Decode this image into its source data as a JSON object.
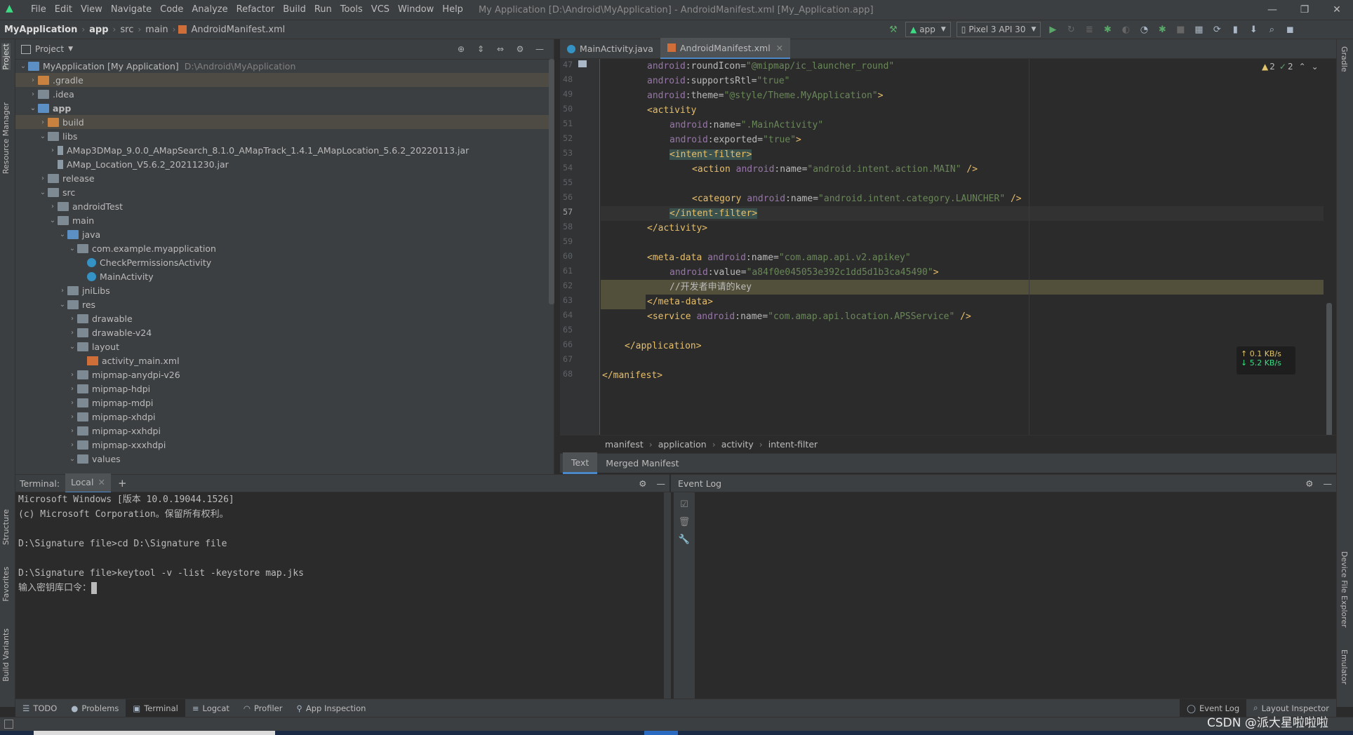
{
  "menubar": {
    "items": [
      "File",
      "Edit",
      "View",
      "Navigate",
      "Code",
      "Analyze",
      "Refactor",
      "Build",
      "Run",
      "Tools",
      "VCS",
      "Window",
      "Help"
    ],
    "title": "My Application [D:\\Android\\MyApplication] - AndroidManifest.xml [My_Application.app]"
  },
  "navbar": {
    "crumbs": [
      "MyApplication",
      "app",
      "src",
      "main",
      "AndroidManifest.xml"
    ],
    "run_config": "app",
    "device": "Pixel 3 API 30"
  },
  "stripes": {
    "left": [
      "Project",
      "Resource Manager",
      "Structure",
      "Favorites",
      "Build Variants"
    ],
    "right": [
      "Gradle",
      "Device File Explorer",
      "Emulator"
    ]
  },
  "project": {
    "title": "Project",
    "tree": [
      {
        "label": "MyApplication [My Application]",
        "path": "D:\\Android\\MyApplication"
      },
      {
        "label": ".gradle"
      },
      {
        "label": ".idea"
      },
      {
        "label": "app"
      },
      {
        "label": "build"
      },
      {
        "label": "libs"
      },
      {
        "label": "AMap3DMap_9.0.0_AMapSearch_8.1.0_AMapTrack_1.4.1_AMapLocation_5.6.2_20220113.jar"
      },
      {
        "label": "AMap_Location_V5.6.2_20211230.jar"
      },
      {
        "label": "release"
      },
      {
        "label": "src"
      },
      {
        "label": "androidTest"
      },
      {
        "label": "main"
      },
      {
        "label": "java"
      },
      {
        "label": "com.example.myapplication"
      },
      {
        "label": "CheckPermissionsActivity"
      },
      {
        "label": "MainActivity"
      },
      {
        "label": "jniLibs"
      },
      {
        "label": "res"
      },
      {
        "label": "drawable"
      },
      {
        "label": "drawable-v24"
      },
      {
        "label": "layout"
      },
      {
        "label": "activity_main.xml"
      },
      {
        "label": "mipmap-anydpi-v26"
      },
      {
        "label": "mipmap-hdpi"
      },
      {
        "label": "mipmap-mdpi"
      },
      {
        "label": "mipmap-xhdpi"
      },
      {
        "label": "mipmap-xxhdpi"
      },
      {
        "label": "mipmap-xxxhdpi"
      },
      {
        "label": "values"
      }
    ]
  },
  "editor": {
    "tabs": [
      "MainActivity.java",
      "AndroidManifest.xml"
    ],
    "line_numbers": [
      "47",
      "48",
      "49",
      "50",
      "51",
      "52",
      "53",
      "54",
      "55",
      "56",
      "57",
      "58",
      "59",
      "60",
      "61",
      "62",
      "63",
      "64",
      "65",
      "66",
      "67",
      "68"
    ],
    "code": {
      "l47_attr": "roundIcon",
      "l47_val": "\"@mipmap/ic_launcher_round\"",
      "l48_attr": "supportsRtl",
      "l48_val": "\"true\"",
      "l49_attr": "theme",
      "l49_val": "\"@style/Theme.MyApplication\"",
      "l50": "<activity",
      "l51_attr": "name",
      "l51_val": "\".MainActivity\"",
      "l52_attr": "exported",
      "l52_val": "\"true\"",
      "l53": "<intent-filter>",
      "l54_tag": "<action",
      "l54_attr": "name",
      "l54_val": "\"android.intent.action.MAIN\"",
      "l54_end": " />",
      "l56_tag": "<category",
      "l56_attr": "name",
      "l56_val": "\"android.intent.category.LAUNCHER\"",
      "l56_end": " />",
      "l57": "</intent-filter>",
      "l58": "</activity>",
      "l60_tag": "<meta-data",
      "l60_attr": "name",
      "l60_val": "\"com.amap.api.v2.apikey\"",
      "l61_attr": "value",
      "l61_val": "\"a84f0e045053e392c1dd5d1b3ca45490\"",
      "l61_end": ">",
      "l62": "//开发者申请的key",
      "l63": "</meta-data>",
      "l64_tag": "<service",
      "l64_attr": "name",
      "l64_val": "\"com.amap.api.location.APSService\"",
      "l64_end": " />",
      "l66": "</application>",
      "l68": "</manifest>",
      "ns": "android"
    },
    "warnings": "2",
    "checks": "2",
    "net_up": "↑ 0.1 KB/s",
    "net_down": "↓ 5.2 KB/s",
    "breadcrumbs": [
      "manifest",
      "application",
      "activity",
      "intent-filter"
    ],
    "bottom_tabs": [
      "Text",
      "Merged Manifest"
    ]
  },
  "terminal": {
    "label": "Terminal:",
    "tab": "Local",
    "lines": [
      "Microsoft Windows [版本 10.0.19044.1526]",
      "(c) Microsoft Corporation。保留所有权利。",
      "",
      "D:\\Signature file>cd D:\\Signature file",
      "",
      "D:\\Signature file>keytool -v -list -keystore map.jks",
      "输入密钥库口令："
    ]
  },
  "eventlog": {
    "title": "Event Log"
  },
  "toolwindows": {
    "left": [
      "TODO",
      "Problems",
      "Terminal",
      "Logcat",
      "Profiler",
      "App Inspection"
    ],
    "right": [
      "Event Log",
      "Layout Inspector"
    ]
  },
  "watermark": "CSDN @派大星啦啦啦"
}
